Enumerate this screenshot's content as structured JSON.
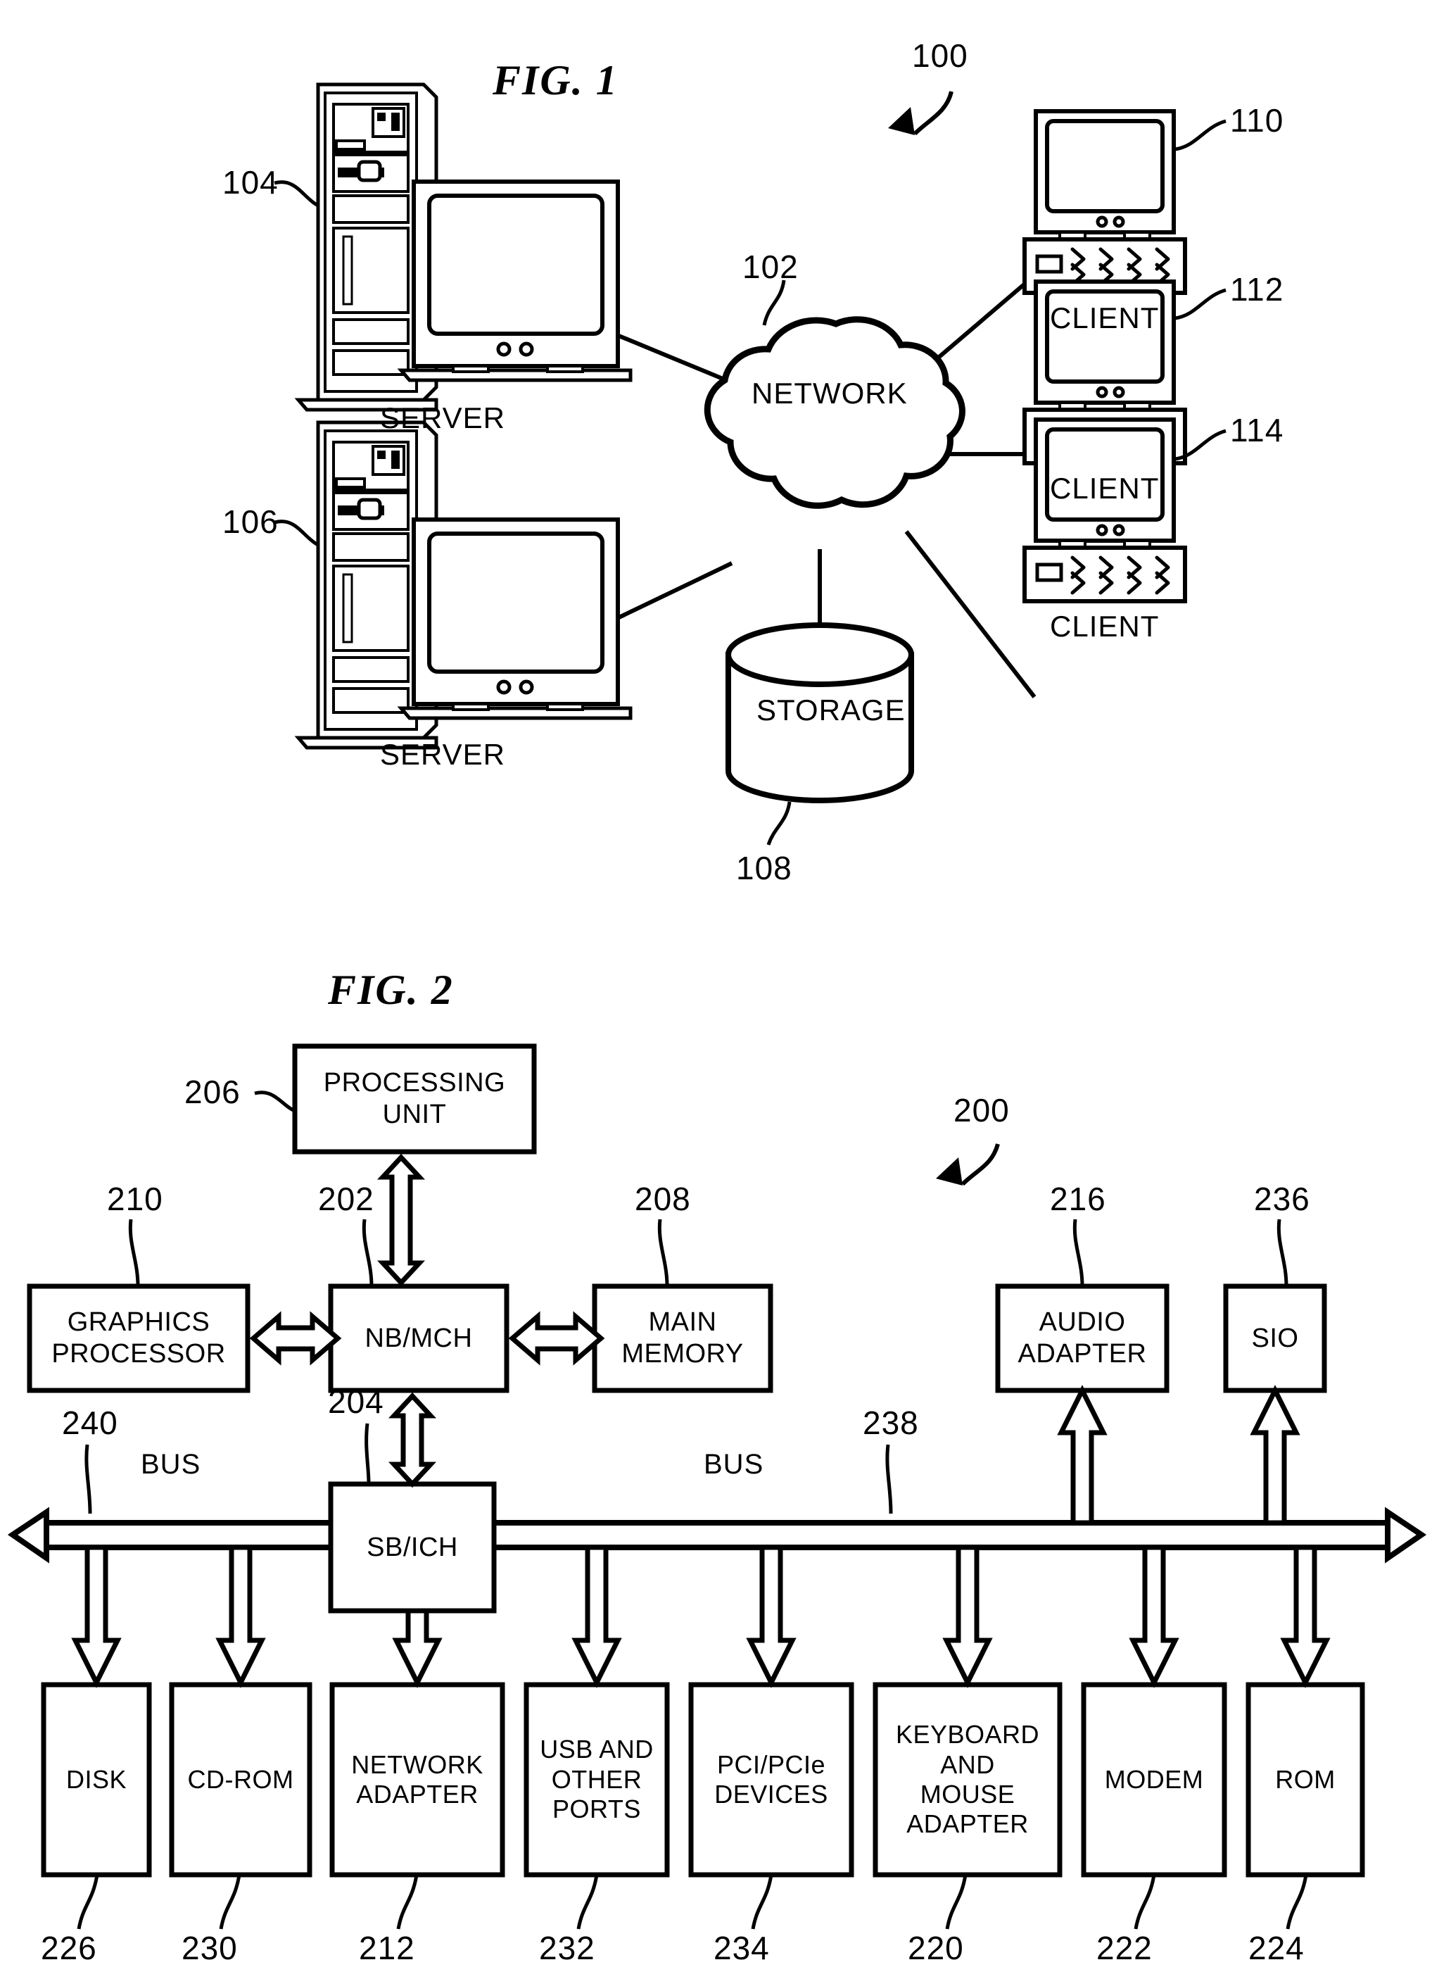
{
  "figures": [
    {
      "title": "FIG. 1",
      "ref": "100",
      "nodes": {
        "network": {
          "label": "NETWORK",
          "ref": "102"
        },
        "storage": {
          "label": "STORAGE",
          "ref": "108"
        },
        "server_top": {
          "label": "SERVER",
          "ref": "104"
        },
        "server_bottom": {
          "label": "SERVER",
          "ref": "106"
        },
        "client_1": {
          "label": "CLIENT",
          "ref": "110"
        },
        "client_2": {
          "label": "CLIENT",
          "ref": "112"
        },
        "client_3": {
          "label": "CLIENT",
          "ref": "114"
        }
      }
    },
    {
      "title": "FIG. 2",
      "ref": "200",
      "boxes": {
        "processing_unit": {
          "label": "PROCESSING\nUNIT",
          "ref": "206"
        },
        "graphics_processor": {
          "label": "GRAPHICS\nPROCESSOR",
          "ref": "210"
        },
        "nb_mch": {
          "label": "NB/MCH",
          "ref": "202"
        },
        "main_memory": {
          "label": "MAIN\nMEMORY",
          "ref": "208"
        },
        "audio_adapter": {
          "label": "AUDIO\nADAPTER",
          "ref": "216"
        },
        "sio": {
          "label": "SIO",
          "ref": "236"
        },
        "sb_ich": {
          "label": "SB/ICH",
          "ref": "204"
        },
        "disk": {
          "label": "DISK",
          "ref": "226"
        },
        "cdrom": {
          "label": "CD-ROM",
          "ref": "230"
        },
        "network_adapter": {
          "label": "NETWORK\nADAPTER",
          "ref": "212"
        },
        "usb_ports": {
          "label": "USB AND\nOTHER\nPORTS",
          "ref": "232"
        },
        "pci_devices": {
          "label": "PCI/PCIe\nDEVICES",
          "ref": "234"
        },
        "keyboard_mouse": {
          "label": "KEYBOARD\nAND\nMOUSE\nADAPTER",
          "ref": "220"
        },
        "modem": {
          "label": "MODEM",
          "ref": "222"
        },
        "rom": {
          "label": "ROM",
          "ref": "224"
        }
      },
      "buses": {
        "left": {
          "label": "BUS",
          "ref": "240"
        },
        "right": {
          "label": "BUS",
          "ref": "238"
        }
      }
    }
  ],
  "colors": {
    "ink": "#000000",
    "paper": "#ffffff"
  }
}
